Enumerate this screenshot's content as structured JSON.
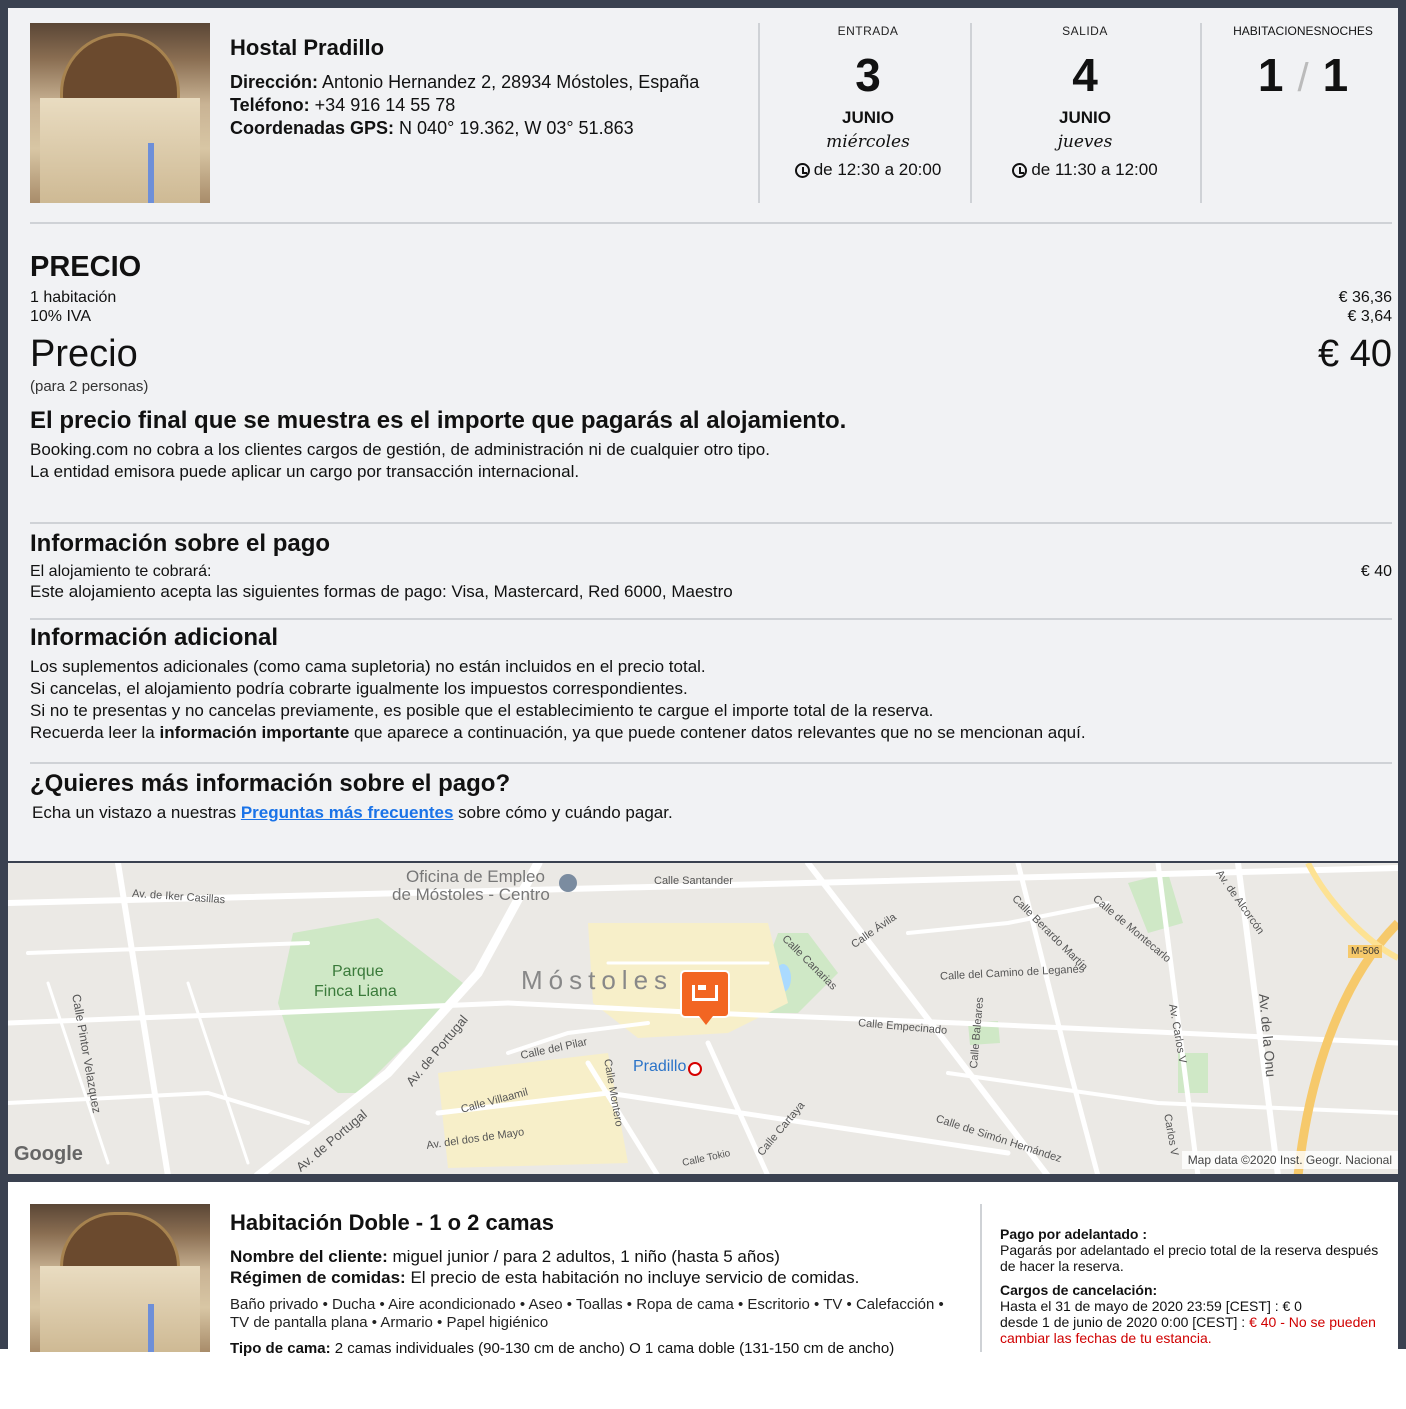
{
  "hotel": {
    "name": "Hostal Pradillo",
    "address_label": "Dirección:",
    "address": "Antonio Hernandez 2, 28934 Móstoles, España",
    "phone_label": "Teléfono:",
    "phone": "+34 916 14 55 78",
    "gps_label": "Coordenadas GPS:",
    "gps": "N 040° 19.362, W 03° 51.863"
  },
  "checkin": {
    "label": "ENTRADA",
    "day": "3",
    "month": "JUNIO",
    "weekday": "miércoles",
    "time": "de 12:30 a 20:00"
  },
  "checkout": {
    "label": "SALIDA",
    "day": "4",
    "month": "JUNIO",
    "weekday": "jueves",
    "time": "de 11:30 a 12:00"
  },
  "stay": {
    "label": "HABITACIONESNOCHES",
    "rooms": "1",
    "separator": "/",
    "nights": "1"
  },
  "price": {
    "heading": "PRECIO",
    "lines": [
      {
        "label": "1 habitación",
        "amount": "€ 36,36"
      },
      {
        "label": "10% IVA",
        "amount": "€ 3,64"
      }
    ],
    "total_label": "Precio",
    "total_amount": "€ 40",
    "people_note": "(para 2 personas)",
    "final_heading": "El precio final que se muestra es el importe que pagarás al alojamiento.",
    "final_line1": "Booking.com no cobra a los clientes cargos de gestión, de administración ni de cualquier otro tipo.",
    "final_line2": "La entidad emisora puede aplicar un cargo por transacción internacional."
  },
  "payment": {
    "heading": "Información sobre el pago",
    "charge_label": "El alojamiento te cobrará:",
    "charge_amount": "€ 40",
    "methods": "Este alojamiento acepta las siguientes formas de pago: Visa, Mastercard, Red 6000, Maestro"
  },
  "additional": {
    "heading": "Información adicional",
    "line1": "Los suplementos adicionales (como cama supletoria) no están incluidos en el precio total.",
    "line2": "Si cancelas, el alojamiento podría cobrarte igualmente los impuestos correspondientes.",
    "line3": "Si no te presentas y no cancelas previamente, es posible que el establecimiento te cargue el importe total de la reserva.",
    "line4_pre": "Recuerda leer la ",
    "line4_bold": "información importante",
    "line4_post": " que aparece a continuación, ya que puede contener datos relevantes que no se mencionan aquí."
  },
  "faq": {
    "heading": "¿Quieres más información sobre el pago?",
    "pre": "Echa un vistazo a nuestras ",
    "link": "Preguntas más frecuentes",
    "post": " sobre cómo y cuándo pagar."
  },
  "map": {
    "labels": {
      "oficina1": "Oficina de Empleo",
      "oficina2": "de Móstoles - Centro",
      "santander": "Calle Santander",
      "iker": "Av. de Iker Casillas",
      "pintor": "Calle Pintor Velazquez",
      "parque1": "Parque",
      "parque2": "Finca Liana",
      "portugal1": "Av. de Portugal",
      "portugal2": "Av. de Portugal",
      "mostoles": "Móstoles",
      "pradillo": "Pradillo",
      "pilar": "Calle del Pilar",
      "villaamil": "Calle Villaamil",
      "montero": "Calle Montero",
      "dosmayo": "Av. del dos de Mayo",
      "tokio": "Calle Tokio",
      "cartaya": "Calle Cartaya",
      "empecinado": "Calle Empecinado",
      "baleares": "Calle Baleares",
      "leganes": "Calle del Camino de Leganés",
      "canarias": "Calle Canarias",
      "avila": "Calle Ávila",
      "berardo": "Calle Berardo Martín",
      "montecarlo": "Calle de Montecarlo",
      "alcorcon": "Av. de Alcorcón",
      "m506": "M-506",
      "carlosv": "Av. Carlos V",
      "carlosv2": "Carlos V",
      "onu": "Av. de la Onu",
      "simon": "Calle de Simón Hernández"
    },
    "google": "Google",
    "attribution": "Map data ©2020 Inst. Geogr. Nacional"
  },
  "room": {
    "title": "Habitación Doble - 1 o 2 camas",
    "guest_label": "Nombre del cliente:",
    "guest": "miguel junior / para 2 adultos, 1 niño (hasta 5 años)",
    "meal_label": "Régimen de comidas:",
    "meal": "El precio de esta habitación no incluye servicio de comidas.",
    "amenities": "Baño privado • Ducha • Aire acondicionado • Aseo • Toallas • Ropa de cama • Escritorio • TV • Calefacción • TV de pantalla plana • Armario • Papel higiénico",
    "bed_label": "Tipo de cama:",
    "bed": "2 camas individuales (90-130 cm de ancho) O 1 cama doble (131-150 cm de ancho)"
  },
  "conditions": {
    "prepay_label": "Pago por adelantado :",
    "prepay_text": "Pagarás por adelantado el precio total de la reserva después de hacer la reserva.",
    "cancel_label": "Cargos de cancelación:",
    "cancel_line1": "Hasta el 31 de mayo de 2020 23:59 [CEST] : € 0",
    "cancel_line2_pre": "desde 1 de junio de 2020 0:00 [CEST] : ",
    "cancel_line2_red": "€ 40 - No se pueden cambiar las fechas de tu estancia."
  },
  "colors": {
    "frame": "#3a4150",
    "link": "#1a73e8",
    "pin": "#f26522",
    "red": "#d00000",
    "park": "#cfe8c6"
  }
}
